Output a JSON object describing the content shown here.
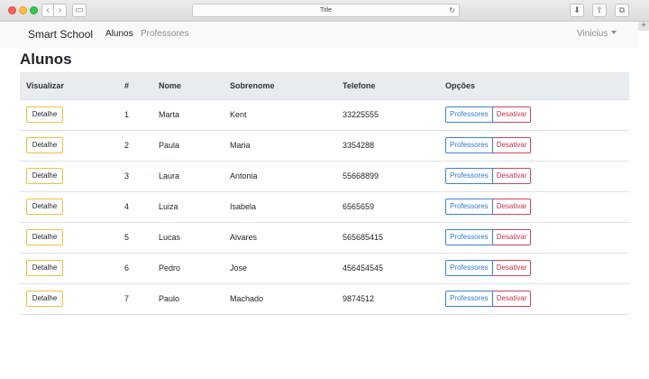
{
  "browser": {
    "title": "Title"
  },
  "navbar": {
    "brand": "Smart School",
    "links": [
      {
        "label": "Alunos",
        "active": true
      },
      {
        "label": "Professores",
        "active": false
      }
    ],
    "user": "Vinicius"
  },
  "page": {
    "title": "Alunos"
  },
  "table": {
    "headers": [
      "Visualizar",
      "#",
      "Nome",
      "Sobrenome",
      "Telefone",
      "Opções"
    ],
    "detail_label": "Detalhe",
    "prof_label": "Professores",
    "deactivate_label": "Desativar",
    "rows": [
      {
        "id": "1",
        "nome": "Marta",
        "sobrenome": "Kent",
        "telefone": "33225555"
      },
      {
        "id": "2",
        "nome": "Paula",
        "sobrenome": "Maria",
        "telefone": "3354288"
      },
      {
        "id": "3",
        "nome": "Laura",
        "sobrenome": "Antonia",
        "telefone": "55668899"
      },
      {
        "id": "4",
        "nome": "Luiza",
        "sobrenome": "Isabela",
        "telefone": "6565659"
      },
      {
        "id": "5",
        "nome": "Lucas",
        "sobrenome": "Alvares",
        "telefone": "565685415"
      },
      {
        "id": "6",
        "nome": "Pedro",
        "sobrenome": "Jose",
        "telefone": "456454545"
      },
      {
        "id": "7",
        "nome": "Paulo",
        "sobrenome": "Machado",
        "telefone": "9874512"
      }
    ]
  },
  "colors": {
    "detail_border": "#f0c040",
    "prof_blue": "#2f7ad1",
    "deactivate_red": "#c9344a",
    "header_bg": "#e9ecef",
    "navbar_bg": "#f8f9fa"
  }
}
